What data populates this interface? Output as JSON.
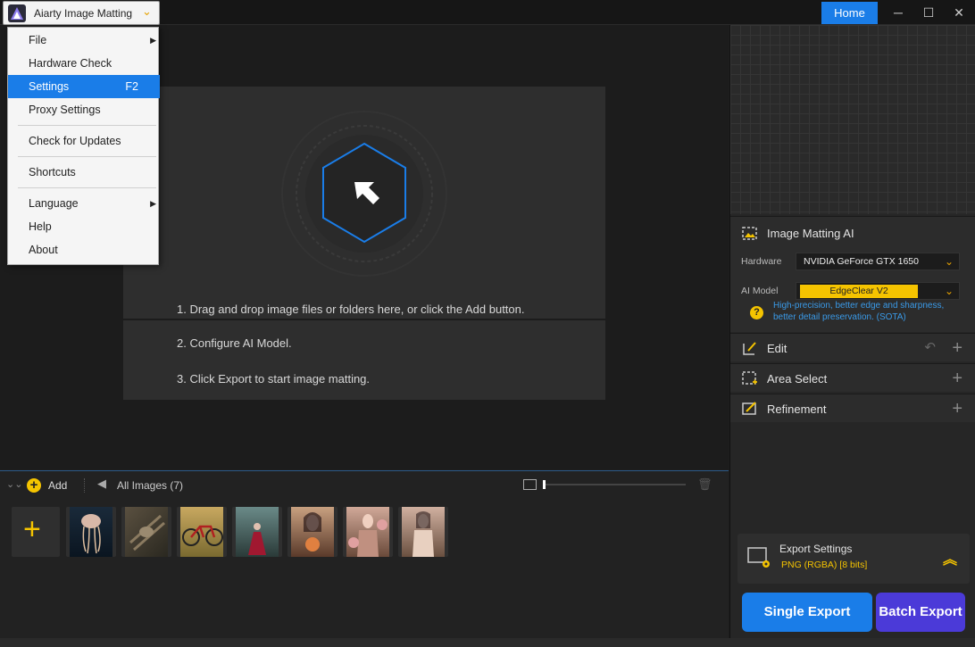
{
  "titlebar": {
    "app_name": "Aiarty Image Matting",
    "home_label": "Home"
  },
  "menu": {
    "items": [
      {
        "label": "File",
        "has_submenu": true
      },
      {
        "label": "Hardware Check"
      },
      {
        "label": "Settings",
        "shortcut": "F2",
        "active": true
      },
      {
        "label": "Proxy Settings"
      },
      {
        "label": "Check for Updates"
      },
      {
        "label": "Shortcuts"
      },
      {
        "label": "Language",
        "has_submenu": true
      },
      {
        "label": "Help"
      },
      {
        "label": "About"
      }
    ]
  },
  "workspace": {
    "steps": [
      "1. Drag and drop image files or folders here, or click the Add button.",
      "2. Configure AI Model.",
      "3. Click Export to start image matting."
    ]
  },
  "bottom": {
    "add_label": "Add",
    "all_images_label": "All Images (7)",
    "thumbnails": [
      {
        "icon": "jellyfish-thumbnail",
        "color": "#3a4a5a"
      },
      {
        "icon": "bird-thumbnail",
        "color": "#4a4438"
      },
      {
        "icon": "bicycle-thumbnail",
        "color": "#6a5a30"
      },
      {
        "icon": "forest-woman-thumbnail",
        "color": "#3c4a48"
      },
      {
        "icon": "woman-flowers-thumbnail",
        "color": "#6a4a3a"
      },
      {
        "icon": "woman-roses-thumbnail",
        "color": "#7a5a4a"
      },
      {
        "icon": "woman-dress-thumbnail",
        "color": "#6a5244"
      }
    ]
  },
  "right": {
    "matting_title": "Image Matting AI",
    "hardware_label": "Hardware",
    "hardware_value": "NVIDIA GeForce GTX 1650",
    "model_label": "AI Model",
    "model_value": "EdgeClear  V2",
    "model_desc_1": "High-precision, better edge and sharpness,",
    "model_desc_2": "better detail preservation. (SOTA)",
    "edit_label": "Edit",
    "area_select_label": "Area Select",
    "refinement_label": "Refinement",
    "export_settings_title": "Export Settings",
    "export_settings_value": "PNG (RGBA) [8 bits]",
    "single_export_label": "Single Export",
    "batch_export_label": "Batch Export"
  },
  "colors": {
    "accent_blue": "#1a7de8",
    "accent_purple": "#4b3ad8",
    "accent_yellow": "#f5c400"
  }
}
